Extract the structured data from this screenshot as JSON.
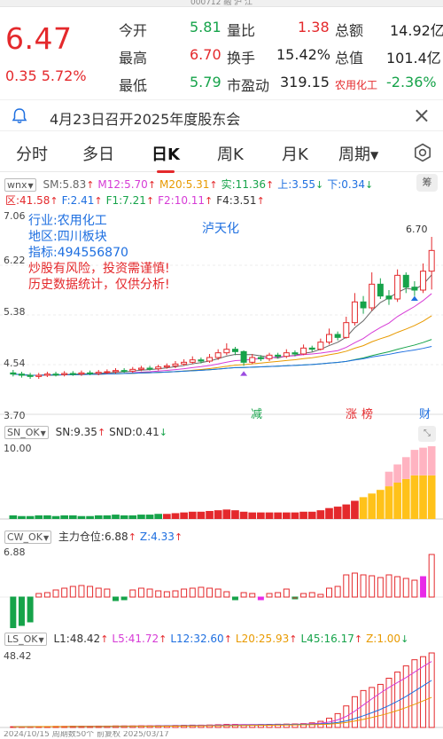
{
  "top_strip": {
    "text": "000712 融 沪 江"
  },
  "quote": {
    "price": "6.47",
    "change": "0.35",
    "change_pct": "5.72%",
    "rows": [
      {
        "l1": "今开",
        "v1": "5.81",
        "l2": "量比",
        "v2": "1.38",
        "l3": "总额",
        "v3": "14.92亿"
      },
      {
        "l1": "最高",
        "v1": "6.70",
        "l2": "换手",
        "v2": "15.42%",
        "l3": "总值",
        "v3": "101.4亿"
      },
      {
        "l1": "最低",
        "v1": "5.79",
        "l2": "市盈动",
        "v2": "319.15",
        "l3": "农用化工",
        "v3": "-2.36%"
      }
    ]
  },
  "announcement": {
    "text": "4月23日召开2025年度股东会",
    "icon": "bell-icon",
    "close": "×"
  },
  "tabs": {
    "items": [
      "分时",
      "多日",
      "日K",
      "周K",
      "月K",
      "周期"
    ],
    "active": "日K"
  },
  "main_indicator": {
    "name": "wnx",
    "values": [
      {
        "label": "SM:5.83",
        "dir": "up",
        "color": "#666666"
      },
      {
        "label": "M12:5.70",
        "dir": "up",
        "color": "#d63bd6"
      },
      {
        "label": "M20:5.31",
        "dir": "up",
        "color": "#e89a00"
      },
      {
        "label": "实:11.36",
        "dir": "up",
        "color": "#16a34a"
      },
      {
        "label": "上:3.55",
        "dir": "down",
        "color": "#1e6fe0"
      },
      {
        "label": "下:0.34",
        "dir": "down",
        "color": "#1e6fe0"
      }
    ],
    "values2": [
      {
        "label": "区:41.58",
        "dir": "up",
        "color": "#e4292c"
      },
      {
        "label": "F:2.41",
        "dir": "up",
        "color": "#1e6fe0"
      },
      {
        "label": "F1:7.21",
        "dir": "up",
        "color": "#16a34a"
      },
      {
        "label": "F2:10.11",
        "dir": "up",
        "color": "#d63bd6"
      },
      {
        "label": "F4:3.51",
        "dir": "up",
        "color": "#333333"
      }
    ],
    "button": "筹"
  },
  "info": {
    "industry_label": "行业:",
    "industry": "农用化工",
    "region_label": "地区:",
    "region": "四川板块",
    "indicator_label": "指标:",
    "indicator": "494556870",
    "warn1": "炒股有风险，投资需谨慎!",
    "warn2": "历史数据统计，仅供分析!",
    "sector": "泸天化"
  },
  "price_axis": {
    "labels": [
      "7.06",
      "6.22",
      "5.38",
      "4.54",
      "3.70"
    ],
    "high_mark": "6.70",
    "markers": [
      "减",
      "涨",
      "榜",
      "财"
    ]
  },
  "sn_indicator": {
    "name": "SN_OK",
    "values": [
      {
        "label": "SN:9.35",
        "dir": "up",
        "color": "#333333"
      },
      {
        "label": "SND:0.41",
        "dir": "down",
        "color": "#333333"
      }
    ],
    "axis_top": "10.00"
  },
  "cw_indicator": {
    "name": "CW_OK",
    "values": [
      {
        "label": "主力仓位:6.88",
        "dir": "up",
        "color": "#333333"
      },
      {
        "label": "Z:4.33",
        "dir": "up",
        "color": "#1e6fe0"
      }
    ],
    "axis_top": "6.88"
  },
  "ls_indicator": {
    "name": "LS_OK",
    "values": [
      {
        "label": "L1:48.42",
        "dir": "up",
        "color": "#333333"
      },
      {
        "label": "L5:41.72",
        "dir": "up",
        "color": "#d63bd6"
      },
      {
        "label": "L12:32.60",
        "dir": "up",
        "color": "#1e6fe0"
      },
      {
        "label": "L20:25.93",
        "dir": "up",
        "color": "#e89a00"
      },
      {
        "label": "L45:16.17",
        "dir": "up",
        "color": "#16a34a"
      },
      {
        "label": "Z:1.00",
        "dir": "down",
        "color": "#e89a00"
      }
    ],
    "axis_top": "48.42"
  },
  "bottom_strip": {
    "text": "2024/10/15   周期数50个   前复权                               2025/03/17"
  },
  "chart_data": {
    "type": "candlestick",
    "ylim": [
      3.7,
      7.06
    ],
    "candles": [
      [
        4.4,
        4.38,
        4.45,
        4.34
      ],
      [
        4.38,
        4.36,
        4.42,
        4.32
      ],
      [
        4.36,
        4.34,
        4.4,
        4.3
      ],
      [
        4.34,
        4.36,
        4.4,
        4.3
      ],
      [
        4.36,
        4.38,
        4.42,
        4.33
      ],
      [
        4.38,
        4.37,
        4.42,
        4.34
      ],
      [
        4.37,
        4.39,
        4.43,
        4.34
      ],
      [
        4.39,
        4.38,
        4.43,
        4.35
      ],
      [
        4.38,
        4.4,
        4.44,
        4.35
      ],
      [
        4.4,
        4.39,
        4.44,
        4.36
      ],
      [
        4.39,
        4.41,
        4.45,
        4.36
      ],
      [
        4.41,
        4.42,
        4.46,
        4.38
      ],
      [
        4.42,
        4.44,
        4.48,
        4.39
      ],
      [
        4.44,
        4.43,
        4.48,
        4.4
      ],
      [
        4.43,
        4.46,
        4.5,
        4.4
      ],
      [
        4.46,
        4.48,
        4.52,
        4.43
      ],
      [
        4.48,
        4.47,
        4.52,
        4.44
      ],
      [
        4.47,
        4.5,
        4.54,
        4.44
      ],
      [
        4.5,
        4.52,
        4.56,
        4.47
      ],
      [
        4.52,
        4.55,
        4.6,
        4.48
      ],
      [
        4.55,
        4.58,
        4.63,
        4.52
      ],
      [
        4.58,
        4.62,
        4.68,
        4.55
      ],
      [
        4.62,
        4.6,
        4.66,
        4.56
      ],
      [
        4.6,
        4.66,
        4.72,
        4.57
      ],
      [
        4.66,
        4.74,
        4.8,
        4.62
      ],
      [
        4.74,
        4.8,
        4.9,
        4.7
      ],
      [
        4.8,
        4.76,
        4.84,
        4.7
      ],
      [
        4.76,
        4.58,
        4.78,
        4.52
      ],
      [
        4.58,
        4.66,
        4.72,
        4.55
      ],
      [
        4.66,
        4.64,
        4.7,
        4.6
      ],
      [
        4.64,
        4.7,
        4.74,
        4.6
      ],
      [
        4.7,
        4.68,
        4.74,
        4.64
      ],
      [
        4.68,
        4.74,
        4.8,
        4.65
      ],
      [
        4.74,
        4.72,
        4.78,
        4.68
      ],
      [
        4.72,
        4.82,
        4.88,
        4.7
      ],
      [
        4.82,
        4.8,
        4.86,
        4.76
      ],
      [
        4.8,
        4.92,
        4.98,
        4.78
      ],
      [
        4.92,
        5.05,
        5.15,
        4.88
      ],
      [
        5.05,
        5.0,
        5.1,
        4.95
      ],
      [
        5.0,
        5.25,
        5.35,
        4.98
      ],
      [
        5.25,
        5.6,
        5.75,
        5.2
      ],
      [
        5.6,
        5.5,
        5.7,
        5.4
      ],
      [
        5.5,
        5.9,
        6.1,
        5.45
      ],
      [
        5.9,
        5.7,
        6.0,
        5.65
      ],
      [
        5.7,
        5.65,
        5.8,
        5.55
      ],
      [
        5.65,
        6.05,
        6.15,
        5.6
      ],
      [
        6.05,
        5.85,
        6.1,
        5.75
      ],
      [
        5.85,
        5.8,
        5.95,
        5.7
      ],
      [
        5.8,
        6.12,
        6.25,
        5.75
      ],
      [
        6.12,
        6.47,
        6.7,
        5.81
      ]
    ],
    "sn_bars": [
      0.5,
      0.4,
      0.4,
      0.5,
      0.5,
      0.4,
      0.5,
      0.5,
      0.4,
      0.4,
      0.5,
      0.5,
      0.6,
      0.5,
      0.5,
      0.6,
      0.6,
      0.7,
      0.7,
      0.8,
      0.9,
      1.0,
      1.0,
      1.1,
      1.2,
      1.3,
      1.2,
      1.0,
      0.9,
      0.9,
      0.9,
      0.9,
      0.9,
      0.9,
      1.0,
      1.0,
      1.2,
      1.5,
      1.7,
      2.0,
      2.5,
      3.0,
      3.5,
      4.0,
      4.5,
      5.0,
      5.5,
      6.0,
      6.0,
      6.0
    ],
    "sn_top": [
      0,
      0,
      0,
      0,
      0,
      0,
      0,
      0,
      0,
      0,
      0,
      0,
      0,
      0,
      0,
      0,
      0,
      0,
      0,
      0,
      0,
      0,
      0,
      0,
      0,
      0,
      0,
      0,
      0,
      0,
      0,
      0,
      0,
      0,
      0,
      0,
      0,
      0,
      0,
      0,
      0,
      0,
      0,
      0,
      2.0,
      2.5,
      3.0,
      3.5,
      3.8,
      4.0
    ],
    "cw_values": [
      -3.5,
      -3.2,
      -2.8,
      0.4,
      0.5,
      0.8,
      1.0,
      1.2,
      1.3,
      1.2,
      1.0,
      0.9,
      -0.4,
      -0.3,
      0.8,
      1.0,
      0.9,
      0.7,
      0.6,
      0.7,
      0.9,
      1.0,
      1.1,
      1.0,
      0.9,
      0.6,
      -0.3,
      0.5,
      0.4,
      -0.3,
      0.4,
      0.5,
      0.9,
      -0.2,
      0.4,
      0.5,
      0.3,
      1.0,
      1.2,
      2.5,
      2.7,
      2.5,
      2.4,
      2.2,
      2.5,
      2.3,
      2.1,
      1.9,
      2.3,
      4.8
    ],
    "ls_values": [
      0.5,
      0.5,
      0.6,
      0.6,
      0.6,
      0.7,
      0.7,
      0.8,
      0.8,
      0.8,
      0.9,
      0.9,
      1.0,
      1.0,
      1.0,
      1.1,
      1.1,
      1.2,
      1.2,
      1.3,
      1.4,
      1.5,
      1.5,
      1.6,
      1.8,
      2.0,
      2.0,
      1.8,
      1.8,
      1.9,
      2.0,
      2.1,
      2.2,
      2.3,
      2.5,
      3.0,
      4.0,
      6.0,
      9.0,
      14.0,
      20.0,
      24.0,
      26.0,
      28.0,
      32.0,
      36.0,
      40.0,
      44.0,
      46.0,
      48.42
    ]
  }
}
